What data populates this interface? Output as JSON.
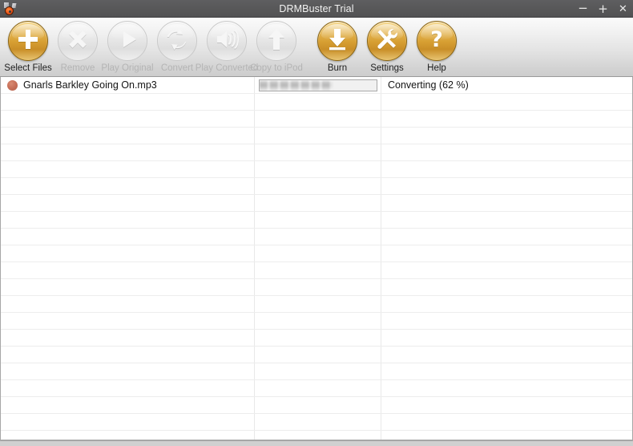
{
  "window": {
    "title": "DRMBuster Trial",
    "icon_name": "drmbuster-app-icon",
    "controls": {
      "minimize": "−",
      "maximize": "+",
      "close": "✕"
    }
  },
  "toolbar": {
    "buttons": [
      {
        "id": "select-files",
        "label": "Select Files",
        "icon": "plus-icon",
        "enabled": true
      },
      {
        "id": "remove",
        "label": "Remove",
        "icon": "cross-icon",
        "enabled": false
      },
      {
        "id": "play-original",
        "label": "Play Original",
        "icon": "play-icon",
        "enabled": false
      },
      {
        "id": "convert",
        "label": "Convert",
        "icon": "refresh-arrows-icon",
        "enabled": false
      },
      {
        "id": "play-converted",
        "label": "Play Converted",
        "icon": "speaker-icon",
        "enabled": false
      },
      {
        "id": "copy-to-ipod",
        "label": "Copy to iPod",
        "icon": "up-arrow-icon",
        "enabled": false
      },
      {
        "id": "burn",
        "label": "Burn",
        "icon": "download-arrow-icon",
        "enabled": true
      },
      {
        "id": "settings",
        "label": "Settings",
        "icon": "tools-icon",
        "enabled": true
      },
      {
        "id": "help",
        "label": "Help",
        "icon": "question-mark-icon",
        "enabled": true
      }
    ]
  },
  "file_list": {
    "rows": [
      {
        "status_dot": "orange-status-dot",
        "name": "Gnarls Barkley Going On.mp3",
        "progress_percent": 62,
        "status": "Converting (62 %)"
      }
    ],
    "empty_row_count": 20,
    "column_divider_x": [
      317,
      475
    ]
  },
  "colors": {
    "titlebar": "#585859",
    "accent_gold": "#d79f33",
    "status_dot": "#c9715a",
    "toolbar_border": "#9a9a9a"
  }
}
